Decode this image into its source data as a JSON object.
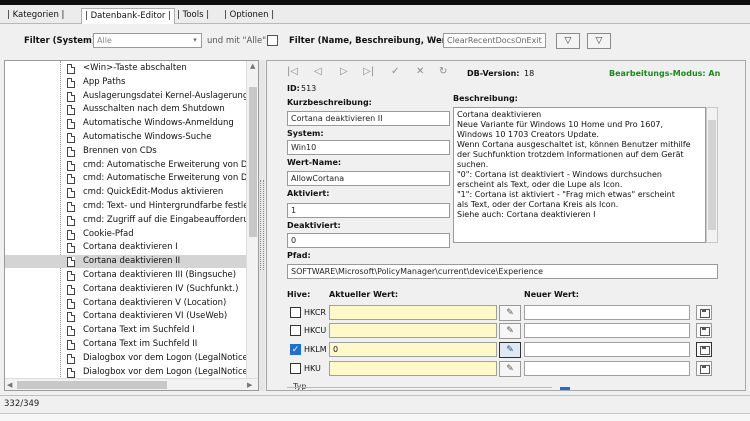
{
  "tabs": [
    "| Kategorien |",
    "| Datenbank-Editor |",
    "| Tools |",
    "| Optionen |"
  ],
  "filter": {
    "system_label": "Filter (System):",
    "system_value": "Alle",
    "and_with": "und mit \"Alle\"",
    "name_label": "Filter (Name, Beschreibung, Wert):",
    "name_value": "ClearRecentDocsOnExit"
  },
  "tree": {
    "items": [
      "<Win>-Taste abschalten",
      "App Paths",
      "Auslagerungsdatei Kernel-Auslagerung v",
      "Ausschalten nach dem Shutdown",
      "Automatische Windows-Anmeldung",
      "Automatische Windows-Suche",
      "Brennen von CDs",
      "cmd: Automatische Erweiterung von Da",
      "cmd: Automatische Erweiterung von Da",
      "cmd: QuickEdit-Modus aktivieren",
      "cmd: Text- und Hintergrundfarbe festle",
      "cmd: Zugriff auf die Eingabeaufforderun",
      "Cookie-Pfad",
      "Cortana deaktivieren I",
      "Cortana deaktivieren II",
      "Cortana deaktivieren III (Bingsuche)",
      "Cortana deaktivieren IV (Suchfunkt.)",
      "Cortana deaktivieren V (Location)",
      "Cortana deaktivieren VI (UseWeb)",
      "Cortana Text im Suchfeld I",
      "Cortana Text im Suchfeld II",
      "Dialogbox vor dem Logon (LegalNoticeC",
      "Dialogbox vor dem Logon (LegalNoticeT"
    ],
    "selected_index": 14
  },
  "editor": {
    "nav": {
      "first": "|◁",
      "prev": "◁",
      "next": "▷",
      "last": "▷|",
      "ok": "✓",
      "cancel": "✕",
      "refresh": "↻"
    },
    "db_version_label": "DB-Version:",
    "db_version": "18",
    "mode": "Bearbeitungs-Modus: An",
    "id_label": "ID:",
    "id": "513",
    "short_desc_label": "Kurzbeschreibung:",
    "short_desc": "Cortana deaktivieren II",
    "system_label": "System:",
    "system": "Win10",
    "value_name_label": "Wert-Name:",
    "value_name": "AllowCortana",
    "activated_label": "Aktiviert:",
    "activated": "1",
    "deactivated_label": "Deaktiviert:",
    "deactivated": "0",
    "description_label": "Beschreibung:",
    "description": [
      "Cortana deaktivieren",
      "Neue Variante für Windows 10 Home und Pro 1607,",
      "Windows 10 1703 Creators Update.",
      "Wenn Cortana ausgeschaltet ist, können Benutzer mithilfe",
      "der Suchfunktion trotzdem Informationen auf dem Gerät",
      "suchen.",
      "",
      "\"0\": Cortana ist deaktiviert - Windows durchsuchen",
      "erscheint als Text, oder die Lupe als Icon.",
      "\"1\": Cortana ist aktiviert - \"Frag mich etwas\" erscheint",
      "als Text, oder der Cortana Kreis als Icon.",
      "",
      "Siehe auch: Cortana deaktivieren I"
    ],
    "path_label": "Pfad:",
    "path": "SOFTWARE\\Microsoft\\PolicyManager\\current\\device\\Experience",
    "hive_label": "Hive:",
    "current_label": "Aktueller Wert:",
    "new_label": "Neuer Wert:",
    "hives": [
      {
        "name": "HKCR",
        "checked": false,
        "current": ""
      },
      {
        "name": "HKCU",
        "checked": false,
        "current": ""
      },
      {
        "name": "HKLM",
        "checked": true,
        "current": "0"
      },
      {
        "name": "HKU",
        "checked": false,
        "current": ""
      }
    ],
    "type_label": "Typ"
  },
  "status": "332/349"
}
